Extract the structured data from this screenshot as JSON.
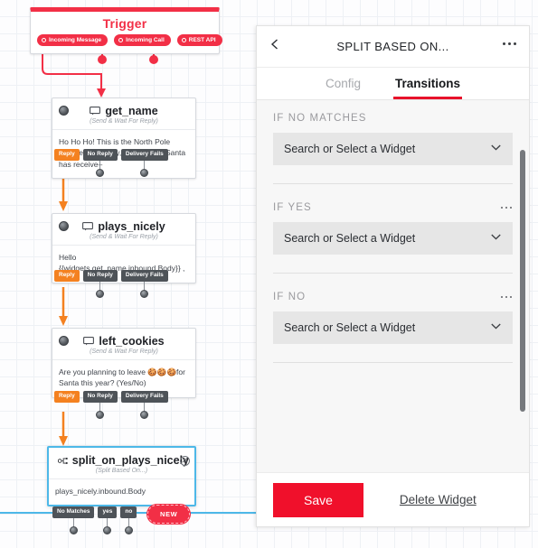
{
  "canvas": {
    "trigger": {
      "title": "Trigger",
      "pills": [
        {
          "label": "Incoming Message",
          "icon": "circle-outline-icon"
        },
        {
          "label": "Incoming Call",
          "icon": "circle-outline-icon"
        },
        {
          "label": "REST API",
          "icon": "circle-outline-icon"
        }
      ]
    },
    "widgets": [
      {
        "name": "get_name",
        "subtitle": "(Send & Wait For Reply)",
        "icon": "chat-bubble-icon",
        "body": "Ho Ho Ho! This is the North Pole textline. For many, many years Santa has receive–",
        "outputs": [
          {
            "label": "Reply",
            "style": "orange"
          },
          {
            "label": "No Reply",
            "style": "gray"
          },
          {
            "label": "Delivery Fails",
            "style": "gray"
          }
        ]
      },
      {
        "name": "plays_nicely",
        "subtitle": "(Send & Wait For Reply)",
        "icon": "chat-bubble-icon",
        "body": "Hello\n{{widgets.get_name.inbound.Body}} ,",
        "outputs": [
          {
            "label": "Reply",
            "style": "orange"
          },
          {
            "label": "No Reply",
            "style": "gray"
          },
          {
            "label": "Delivery Fails",
            "style": "gray"
          }
        ]
      },
      {
        "name": "left_cookies",
        "subtitle": "(Send & Wait For Reply)",
        "icon": "chat-bubble-icon",
        "body": "Are you planning to leave 🍪🍪🍪for Santa this year? (Yes/No)",
        "outputs": [
          {
            "label": "Reply",
            "style": "orange"
          },
          {
            "label": "No Reply",
            "style": "gray"
          },
          {
            "label": "Delivery Fails",
            "style": "gray"
          }
        ]
      },
      {
        "name": "split_on_plays_nicely",
        "subtitle": "(Split Based On...)",
        "icon": "split-branch-icon",
        "body": "plays_nicely.inbound.Body",
        "selected": true,
        "close_icon": "close-icon",
        "outputs": [
          {
            "label": "No Matches",
            "style": "gray"
          },
          {
            "label": "yes",
            "style": "gray"
          },
          {
            "label": "no",
            "style": "gray"
          }
        ],
        "new_button": "NEW"
      }
    ]
  },
  "panel": {
    "header": {
      "title": "SPLIT BASED ON...",
      "back_icon": "chevron-left-icon",
      "menu_icon": "more-horizontal-icon"
    },
    "tabs": [
      {
        "label": "Config",
        "active": false
      },
      {
        "label": "Transitions",
        "active": true
      }
    ],
    "transitions": [
      {
        "label": "IF NO MATCHES",
        "value": "Search or Select a Widget",
        "has_menu": false,
        "chevron_icon": "chevron-down-icon"
      },
      {
        "label": "IF YES",
        "value": "Search or Select a Widget",
        "has_menu": true,
        "menu_icon": "more-horizontal-icon",
        "chevron_icon": "chevron-down-icon"
      },
      {
        "label": "IF NO",
        "value": "Search or Select a Widget",
        "has_menu": true,
        "menu_icon": "more-horizontal-icon",
        "chevron_icon": "chevron-down-icon"
      }
    ],
    "footer": {
      "save_label": "Save",
      "delete_label": "Delete Widget"
    }
  },
  "colors": {
    "brand_red": "#f22f46",
    "save_red": "#f0102b",
    "tab_underline": "#e8132b",
    "connector_orange": "#f48120",
    "connector_blue": "#4db8e8",
    "pill_gray": "#4e5358"
  }
}
